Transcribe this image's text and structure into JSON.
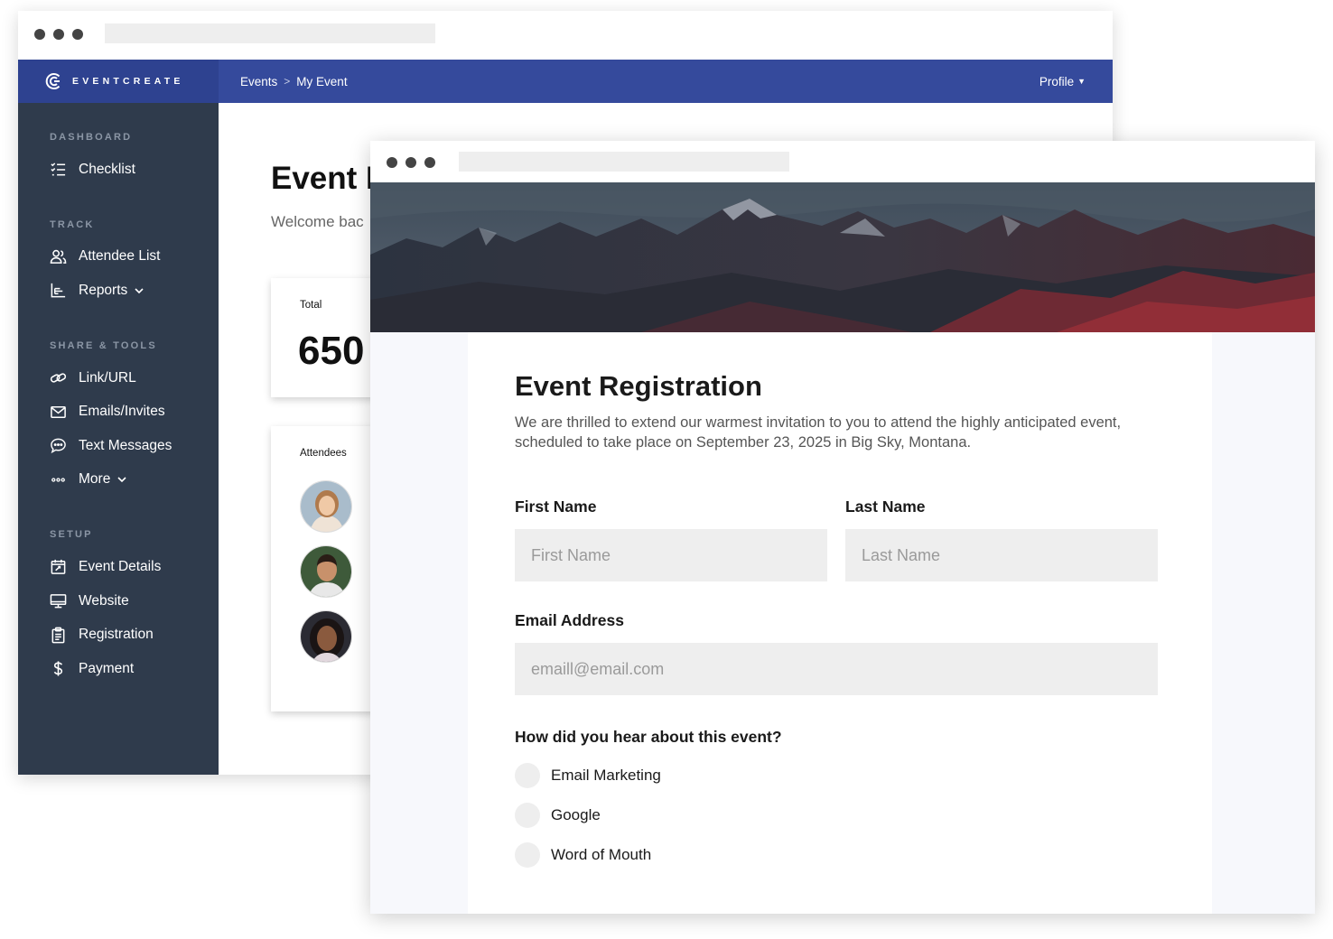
{
  "back_window": {
    "brand": "EVENTCREATE",
    "breadcrumb": [
      "Events",
      "My Event"
    ],
    "breadcrumb_separator": ">",
    "profile_label": "Profile",
    "sidebar": {
      "sections": [
        {
          "label": "DASHBOARD",
          "items": [
            {
              "label": "Checklist",
              "icon": "checklist-icon"
            }
          ]
        },
        {
          "label": "TRACK",
          "items": [
            {
              "label": "Attendee List",
              "icon": "users-icon"
            },
            {
              "label": "Reports",
              "icon": "bar-chart-icon",
              "has_dropdown": true
            }
          ]
        },
        {
          "label": "SHARE & TOOLS",
          "items": [
            {
              "label": "Link/URL",
              "icon": "link-icon"
            },
            {
              "label": "Emails/Invites",
              "icon": "mail-icon"
            },
            {
              "label": "Text Messages",
              "icon": "sms-icon"
            },
            {
              "label": "More",
              "icon": "more-icon",
              "has_dropdown": true
            }
          ]
        },
        {
          "label": "SETUP",
          "items": [
            {
              "label": "Event Details",
              "icon": "calendar-icon"
            },
            {
              "label": "Website",
              "icon": "monitor-icon"
            },
            {
              "label": "Registration",
              "icon": "clipboard-icon"
            },
            {
              "label": "Payment",
              "icon": "dollar-icon"
            }
          ]
        }
      ]
    },
    "main": {
      "title": "Event D",
      "welcome": "Welcome bac",
      "total_card": {
        "label": "Total",
        "value": "650"
      },
      "attendees_card": {
        "label": "Attendees"
      }
    }
  },
  "registration": {
    "title": "Event Registration",
    "description": "We are thrilled to extend our warmest invitation to you to attend the highly anticipated event, scheduled to take place on September 23, 2025 in Big Sky, Montana.",
    "first_name": {
      "label": "First Name",
      "placeholder": "First Name",
      "value": ""
    },
    "last_name": {
      "label": "Last Name",
      "placeholder": "Last Name",
      "value": ""
    },
    "email": {
      "label": "Email Address",
      "placeholder": "emaill@email.com",
      "value": ""
    },
    "question": "How did you hear about this event?",
    "options": [
      "Email Marketing",
      "Google",
      "Word of Mouth"
    ]
  },
  "colors": {
    "topbar": "#354a9c",
    "brand_bg": "#2e4290",
    "sidebar": "#2f3b4c",
    "section_label": "#8b96a5",
    "field_bg": "#eeeeee"
  }
}
